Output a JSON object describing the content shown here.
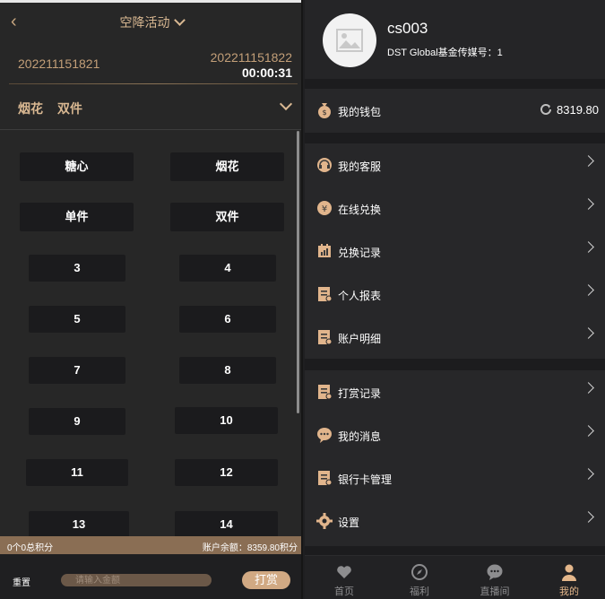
{
  "left": {
    "header": {
      "title": "空降活动"
    },
    "issue": {
      "current": "202211151821",
      "next": "202211151822",
      "countdown": "00:00:31"
    },
    "play": {
      "group": "烟花",
      "mode": "双件"
    },
    "options": [
      "糖心",
      "烟花",
      "单件",
      "双件",
      "3",
      "4",
      "5",
      "6",
      "7",
      "8",
      "9",
      "10",
      "11",
      "12",
      "13",
      "14"
    ],
    "balance_bar": {
      "left": "0个0总积分",
      "right": "账户余额：8359.80积分"
    },
    "bottom": {
      "reset": "重置",
      "amount_placeholder": "请输入金额",
      "submit": "打赏"
    }
  },
  "right": {
    "profile": {
      "name": "cs003",
      "subtitle": "DST Global基金传媒号：1"
    },
    "wallet": {
      "label": "我的钱包",
      "amount": "8319.80"
    },
    "menu_group1": [
      {
        "label": "我的客服",
        "icon": "headset-icon"
      },
      {
        "label": "在线兑换",
        "icon": "exchange-icon"
      },
      {
        "label": "兑换记录",
        "icon": "calendar-icon"
      },
      {
        "label": "个人报表",
        "icon": "report-icon"
      },
      {
        "label": "账户明细",
        "icon": "detail-icon"
      }
    ],
    "menu_group2": [
      {
        "label": "打赏记录",
        "icon": "tip-record-icon"
      },
      {
        "label": "我的消息",
        "icon": "message-icon"
      },
      {
        "label": "银行卡管理",
        "icon": "bank-card-icon"
      },
      {
        "label": "设置",
        "icon": "gear-icon"
      }
    ],
    "tabs": [
      {
        "label": "首页",
        "icon": "heart-icon"
      },
      {
        "label": "福利",
        "icon": "compass-icon"
      },
      {
        "label": "直播间",
        "icon": "chat-icon"
      },
      {
        "label": "我的",
        "icon": "person-icon"
      }
    ],
    "active_tab": "我的",
    "colors": {
      "accent": "#e3b68a",
      "gold": "#d9b892",
      "bg": "#1c1c1e"
    }
  }
}
